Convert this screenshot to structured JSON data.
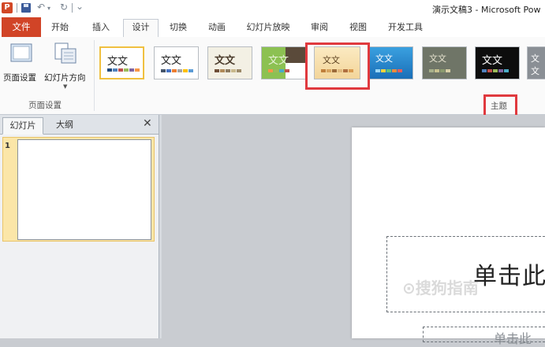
{
  "window": {
    "app_icon_letter": "P",
    "title": "演示文稿3 - Microsoft Pow"
  },
  "quick_access": {
    "undo_glyph": "↶",
    "redo_glyph": "↻",
    "customize_glyph": "⌄"
  },
  "tabs": {
    "file": "文件",
    "items": [
      "开始",
      "插入",
      "设计",
      "切换",
      "动画",
      "幻灯片放映",
      "审阅",
      "视图",
      "开发工具"
    ],
    "active": "设计"
  },
  "ribbon": {
    "page_setup_group": {
      "label": "页面设置",
      "buttons": [
        "页面设置",
        "幻灯片方向"
      ]
    },
    "themes_group": {
      "label": "主题",
      "theme_text": "文文",
      "selected_index": 4
    }
  },
  "slides_panel": {
    "tabs": [
      "幻灯片",
      "大纲"
    ],
    "close_glyph": "✕",
    "slide_number": "1"
  },
  "slide": {
    "title_placeholder": "单击此",
    "subtitle_placeholder": "单击此"
  },
  "watermark": "⊙搜狗指南",
  "colors": {
    "file_tab": "#d14427",
    "highlight": "#e0393e",
    "selected_slide": "#fbe6a8"
  }
}
